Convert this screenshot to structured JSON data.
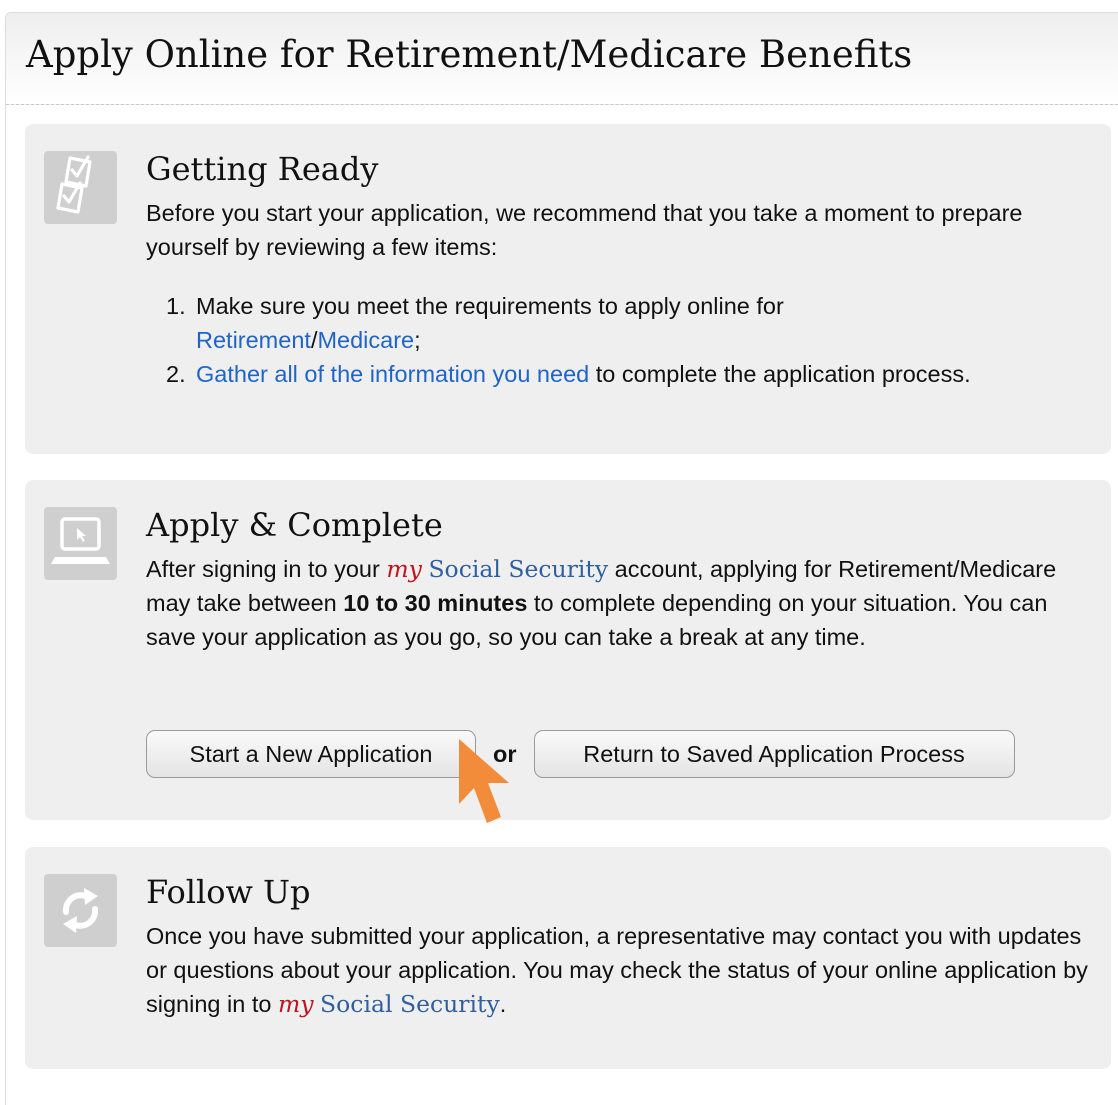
{
  "header": {
    "title": "Apply Online for Retirement/Medicare Benefits"
  },
  "getting_ready": {
    "icon": "checklist-icon",
    "heading": "Getting Ready",
    "intro": "Before you start your application, we recommend that you take a moment to prepare yourself by reviewing a few items:",
    "step1_num": "1.",
    "step1_text": "Make sure you meet the requirements to apply online for",
    "step1_link1": "Retirement",
    "step1_slash": "/",
    "step1_link2": "Medicare",
    "step1_end": ";",
    "step2_num": "2.",
    "step2_link": "Gather all of the information you need",
    "step2_text": " to complete the application process."
  },
  "apply_complete": {
    "icon": "laptop-icon",
    "heading": "Apply & Complete",
    "text_a": "After signing in to your ",
    "brand_my": "my",
    "brand_ss": "Social Security",
    "text_b": " account, applying for Retirement/Medicare may take between ",
    "duration": "10 to 30 minutes",
    "text_c": " to complete depending on your situation. You can save your application as you go, so you can take a break at any time.",
    "start_button": "Start a New Application",
    "or_label": "or",
    "return_button": "Return to Saved Application Process"
  },
  "follow_up": {
    "icon": "refresh-arrows-icon",
    "heading": "Follow Up",
    "text_a": "Once you have submitted your application, a representative may contact you with updates or questions about your application. You may check the status of your online application by signing in to ",
    "brand_my": "my",
    "brand_ss": "Social Security",
    "text_end": "."
  },
  "colors": {
    "link": "#1f65c8",
    "brand_my": "#c0141d",
    "brand_ss": "#2f5f9e",
    "panel_bg": "#efefef",
    "icon_tile": "#cfcfcf",
    "cursor": "#f28c3a"
  },
  "cursor_icon": "mouse-pointer-icon"
}
